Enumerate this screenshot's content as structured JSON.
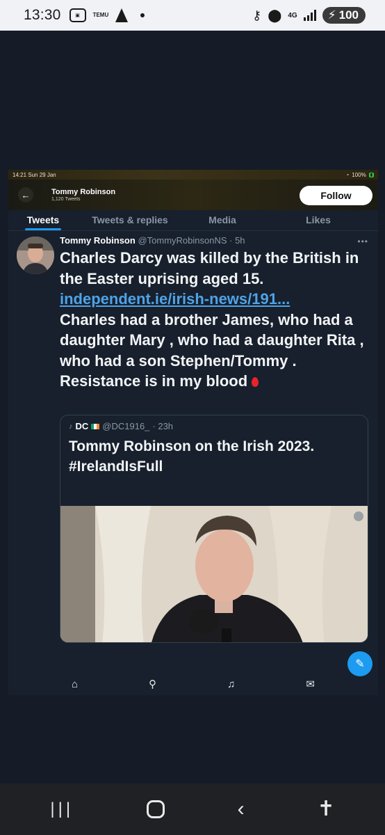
{
  "android_status": {
    "time": "13:30",
    "temu_label": "TEMU",
    "network": "4G",
    "battery": "100"
  },
  "inner_status": {
    "time_date": "14:21  Sun 29 Jan",
    "battery": "100%"
  },
  "profile_header": {
    "name": "Tommy Robinson",
    "tweet_count": "1,120 Tweets",
    "follow_label": "Follow"
  },
  "tabs": [
    {
      "label": "Tweets",
      "active": true
    },
    {
      "label": "Tweets & replies",
      "active": false
    },
    {
      "label": "Media",
      "active": false
    },
    {
      "label": "Likes",
      "active": false
    }
  ],
  "tweet": {
    "author_name": "Tommy Robinson",
    "author_handle": "@TommyRobinsonNS",
    "time": "· 5h",
    "more": "•••",
    "text_line1": "Charles Darcy was killed by the British in the Easter uprising aged 15.",
    "link": "independent.ie/irish-news/191...",
    "text_line2": "Charles had a brother James, who had a daughter Mary , who had a daughter Rita , who had a son Stephen/Tommy . Resistance is in my blood"
  },
  "quote": {
    "author_name": "DC",
    "author_handle": "@DC1916_",
    "time": "· 23h",
    "text_line1": "Tommy Robinson on the Irish 2023.",
    "hashtag": "#IrelandIsFull"
  },
  "icons": {
    "compose": "compose-icon",
    "home": "home-icon",
    "search": "search-icon",
    "notifications": "bell-icon",
    "messages": "mail-icon"
  },
  "colors": {
    "accent": "#1d9bf0",
    "background": "#151c27",
    "link": "#4ea3e8"
  }
}
